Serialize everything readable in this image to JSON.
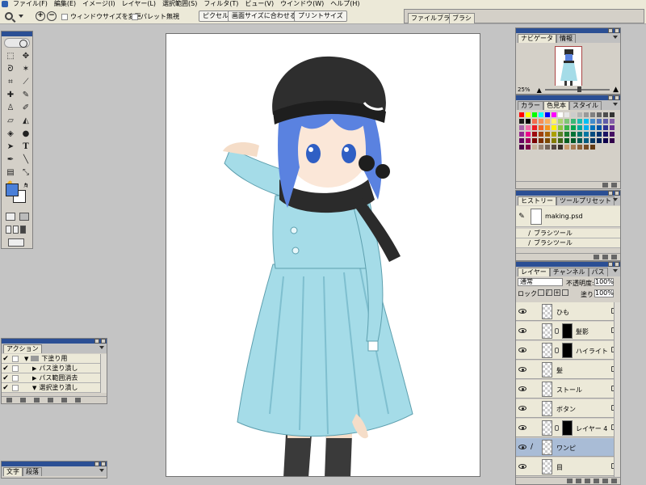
{
  "menubar": {
    "items": [
      "ファイル(F)",
      "編集(E)",
      "イメージ(I)",
      "レイヤー(L)",
      "選択範囲(S)",
      "フィルタ(T)",
      "ビュー(V)",
      "ウインドウ(W)",
      "ヘルプ(H)"
    ]
  },
  "optionsbar": {
    "checkbox_resize": "ウィンドウサイズを変更",
    "checkbox_palette": "パレット無視",
    "btn_actual_pixels": "ピクセル等倍",
    "btn_fit_screen": "画面サイズに合わせる",
    "btn_print_size": "プリントサイズ",
    "well_tab_browser": "ファイルブラウザ",
    "well_tab_brush": "ブラシ"
  },
  "navigator": {
    "tabs": [
      "ナビゲータ",
      "情報"
    ],
    "zoom": "25%"
  },
  "swatches": {
    "tabs": [
      "カラー",
      "色見本",
      "スタイル"
    ],
    "colors": [
      "#ff0000",
      "#ffff00",
      "#00ff00",
      "#00ffff",
      "#0000ff",
      "#ff00ff",
      "#ffffff",
      "#e6e6e6",
      "#cccccc",
      "#b3b3b3",
      "#999999",
      "#808080",
      "#666666",
      "#4d4d4d",
      "#333333",
      "#1a1a1a",
      "#000000",
      "#f26c4f",
      "#f68e55",
      "#fbaf5c",
      "#fff467",
      "#acd372",
      "#7cc576",
      "#3bb878",
      "#1abbb4",
      "#00bff3",
      "#438ccb",
      "#5574b9",
      "#605ca8",
      "#855fa8",
      "#a763a8",
      "#f06ea9",
      "#ed1c24",
      "#f26522",
      "#f7941d",
      "#fff200",
      "#8dc63f",
      "#39b54a",
      "#00a651",
      "#00a99d",
      "#00aeef",
      "#0072bc",
      "#0054a6",
      "#2e3192",
      "#662d91",
      "#92278f",
      "#ec008c",
      "#9e0b0f",
      "#a0410d",
      "#a36209",
      "#aba000",
      "#598527",
      "#1a7b30",
      "#007236",
      "#00746b",
      "#0076a3",
      "#004b80",
      "#003471",
      "#1b1464",
      "#440e62",
      "#630460",
      "#9e005d",
      "#790000",
      "#7b2e00",
      "#7d4900",
      "#827b00",
      "#406618",
      "#005e20",
      "#005826",
      "#005952",
      "#005b7f",
      "#003663",
      "#002157",
      "#0d004c",
      "#32004b",
      "#4b0049",
      "#7b0046",
      "#c7b299",
      "#998675",
      "#736357",
      "#534741",
      "#37302a",
      "#c69c6d",
      "#a67c52",
      "#8c6239",
      "#754c24",
      "#603913"
    ]
  },
  "history": {
    "tabs": [
      "ヒストリー",
      "ツールプリセット"
    ],
    "snapshot": "making.psd",
    "states": [
      "ブラシツール",
      "ブラシツール"
    ]
  },
  "layers": {
    "tabs": [
      "レイヤー",
      "チャンネル",
      "パス"
    ],
    "blend_mode": "通常",
    "opacity_label": "不透明度:",
    "opacity_value": "100%",
    "lock_label": "ロック:",
    "fill_label": "塗り:",
    "fill_value": "100%",
    "rows": [
      {
        "name": "ひも"
      },
      {
        "name": "髪影"
      },
      {
        "name": "ハイライト"
      },
      {
        "name": "髪"
      },
      {
        "name": "ストール"
      },
      {
        "name": "ボタン"
      },
      {
        "name": "レイヤー 4"
      },
      {
        "name": "ワンピ"
      },
      {
        "name": "目"
      }
    ]
  },
  "actions": {
    "tab": "アクション",
    "rows": [
      "下塗り用",
      "パス塗り潰し",
      "パス範囲消去",
      "選択塗り潰し"
    ]
  },
  "character": {
    "tabs": [
      "文字",
      "段落"
    ]
  }
}
